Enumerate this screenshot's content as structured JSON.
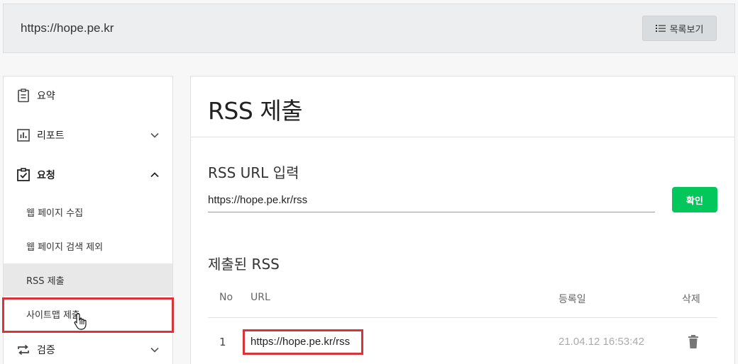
{
  "header": {
    "site_url": "https://hope.pe.kr",
    "list_button_label": "목록보기",
    "list_button_icon": "list-icon"
  },
  "sidebar": {
    "items": [
      {
        "label": "요약",
        "icon": "clipboard-icon"
      },
      {
        "label": "리포트",
        "icon": "bar-chart-icon",
        "chevron": "chevron-down-icon"
      },
      {
        "label": "요청",
        "icon": "checked-clipboard-icon",
        "chevron": "chevron-up-icon"
      },
      {
        "label": "검증",
        "icon": "repeat-icon",
        "chevron": "chevron-down-icon"
      }
    ],
    "sub_items": [
      {
        "label": "웹 페이지 수집"
      },
      {
        "label": "웹 페이지 검색 제외"
      },
      {
        "label": "RSS 제출",
        "active": true
      },
      {
        "label": "사이트맵 제출",
        "highlighted": true
      }
    ]
  },
  "main": {
    "title": "RSS 제출",
    "input_section_title": "RSS URL 입력",
    "input_value": "https://hope.pe.kr/rss",
    "confirm_label": "확인",
    "submitted_title": "제출된 RSS",
    "table": {
      "headers": [
        "No",
        "URL",
        "등록일",
        "삭제"
      ],
      "rows": [
        {
          "no": "1",
          "url": "https://hope.pe.kr/rss",
          "date": "21.04.12 16:53:42",
          "delete_icon": "trash-icon"
        }
      ]
    }
  },
  "colors": {
    "accent_green": "#03c75a",
    "highlight_red": "#d8333b",
    "active_bg": "#e8e8e8"
  }
}
